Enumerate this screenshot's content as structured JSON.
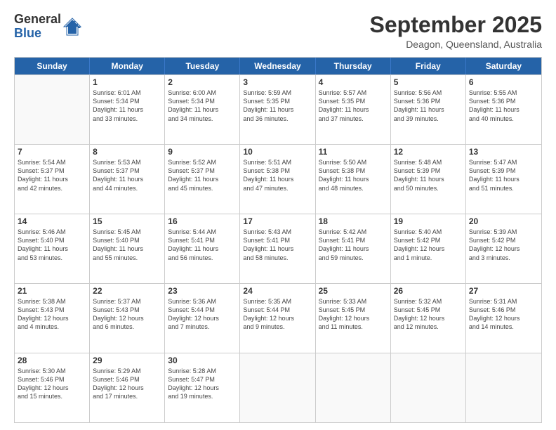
{
  "header": {
    "logo_line1": "General",
    "logo_line2": "Blue",
    "month": "September 2025",
    "location": "Deagon, Queensland, Australia"
  },
  "weekdays": [
    "Sunday",
    "Monday",
    "Tuesday",
    "Wednesday",
    "Thursday",
    "Friday",
    "Saturday"
  ],
  "rows": [
    [
      {
        "day": "",
        "info": ""
      },
      {
        "day": "1",
        "info": "Sunrise: 6:01 AM\nSunset: 5:34 PM\nDaylight: 11 hours\nand 33 minutes."
      },
      {
        "day": "2",
        "info": "Sunrise: 6:00 AM\nSunset: 5:34 PM\nDaylight: 11 hours\nand 34 minutes."
      },
      {
        "day": "3",
        "info": "Sunrise: 5:59 AM\nSunset: 5:35 PM\nDaylight: 11 hours\nand 36 minutes."
      },
      {
        "day": "4",
        "info": "Sunrise: 5:57 AM\nSunset: 5:35 PM\nDaylight: 11 hours\nand 37 minutes."
      },
      {
        "day": "5",
        "info": "Sunrise: 5:56 AM\nSunset: 5:36 PM\nDaylight: 11 hours\nand 39 minutes."
      },
      {
        "day": "6",
        "info": "Sunrise: 5:55 AM\nSunset: 5:36 PM\nDaylight: 11 hours\nand 40 minutes."
      }
    ],
    [
      {
        "day": "7",
        "info": "Sunrise: 5:54 AM\nSunset: 5:37 PM\nDaylight: 11 hours\nand 42 minutes."
      },
      {
        "day": "8",
        "info": "Sunrise: 5:53 AM\nSunset: 5:37 PM\nDaylight: 11 hours\nand 44 minutes."
      },
      {
        "day": "9",
        "info": "Sunrise: 5:52 AM\nSunset: 5:37 PM\nDaylight: 11 hours\nand 45 minutes."
      },
      {
        "day": "10",
        "info": "Sunrise: 5:51 AM\nSunset: 5:38 PM\nDaylight: 11 hours\nand 47 minutes."
      },
      {
        "day": "11",
        "info": "Sunrise: 5:50 AM\nSunset: 5:38 PM\nDaylight: 11 hours\nand 48 minutes."
      },
      {
        "day": "12",
        "info": "Sunrise: 5:48 AM\nSunset: 5:39 PM\nDaylight: 11 hours\nand 50 minutes."
      },
      {
        "day": "13",
        "info": "Sunrise: 5:47 AM\nSunset: 5:39 PM\nDaylight: 11 hours\nand 51 minutes."
      }
    ],
    [
      {
        "day": "14",
        "info": "Sunrise: 5:46 AM\nSunset: 5:40 PM\nDaylight: 11 hours\nand 53 minutes."
      },
      {
        "day": "15",
        "info": "Sunrise: 5:45 AM\nSunset: 5:40 PM\nDaylight: 11 hours\nand 55 minutes."
      },
      {
        "day": "16",
        "info": "Sunrise: 5:44 AM\nSunset: 5:41 PM\nDaylight: 11 hours\nand 56 minutes."
      },
      {
        "day": "17",
        "info": "Sunrise: 5:43 AM\nSunset: 5:41 PM\nDaylight: 11 hours\nand 58 minutes."
      },
      {
        "day": "18",
        "info": "Sunrise: 5:42 AM\nSunset: 5:41 PM\nDaylight: 11 hours\nand 59 minutes."
      },
      {
        "day": "19",
        "info": "Sunrise: 5:40 AM\nSunset: 5:42 PM\nDaylight: 12 hours\nand 1 minute."
      },
      {
        "day": "20",
        "info": "Sunrise: 5:39 AM\nSunset: 5:42 PM\nDaylight: 12 hours\nand 3 minutes."
      }
    ],
    [
      {
        "day": "21",
        "info": "Sunrise: 5:38 AM\nSunset: 5:43 PM\nDaylight: 12 hours\nand 4 minutes."
      },
      {
        "day": "22",
        "info": "Sunrise: 5:37 AM\nSunset: 5:43 PM\nDaylight: 12 hours\nand 6 minutes."
      },
      {
        "day": "23",
        "info": "Sunrise: 5:36 AM\nSunset: 5:44 PM\nDaylight: 12 hours\nand 7 minutes."
      },
      {
        "day": "24",
        "info": "Sunrise: 5:35 AM\nSunset: 5:44 PM\nDaylight: 12 hours\nand 9 minutes."
      },
      {
        "day": "25",
        "info": "Sunrise: 5:33 AM\nSunset: 5:45 PM\nDaylight: 12 hours\nand 11 minutes."
      },
      {
        "day": "26",
        "info": "Sunrise: 5:32 AM\nSunset: 5:45 PM\nDaylight: 12 hours\nand 12 minutes."
      },
      {
        "day": "27",
        "info": "Sunrise: 5:31 AM\nSunset: 5:46 PM\nDaylight: 12 hours\nand 14 minutes."
      }
    ],
    [
      {
        "day": "28",
        "info": "Sunrise: 5:30 AM\nSunset: 5:46 PM\nDaylight: 12 hours\nand 15 minutes."
      },
      {
        "day": "29",
        "info": "Sunrise: 5:29 AM\nSunset: 5:46 PM\nDaylight: 12 hours\nand 17 minutes."
      },
      {
        "day": "30",
        "info": "Sunrise: 5:28 AM\nSunset: 5:47 PM\nDaylight: 12 hours\nand 19 minutes."
      },
      {
        "day": "",
        "info": ""
      },
      {
        "day": "",
        "info": ""
      },
      {
        "day": "",
        "info": ""
      },
      {
        "day": "",
        "info": ""
      }
    ]
  ]
}
